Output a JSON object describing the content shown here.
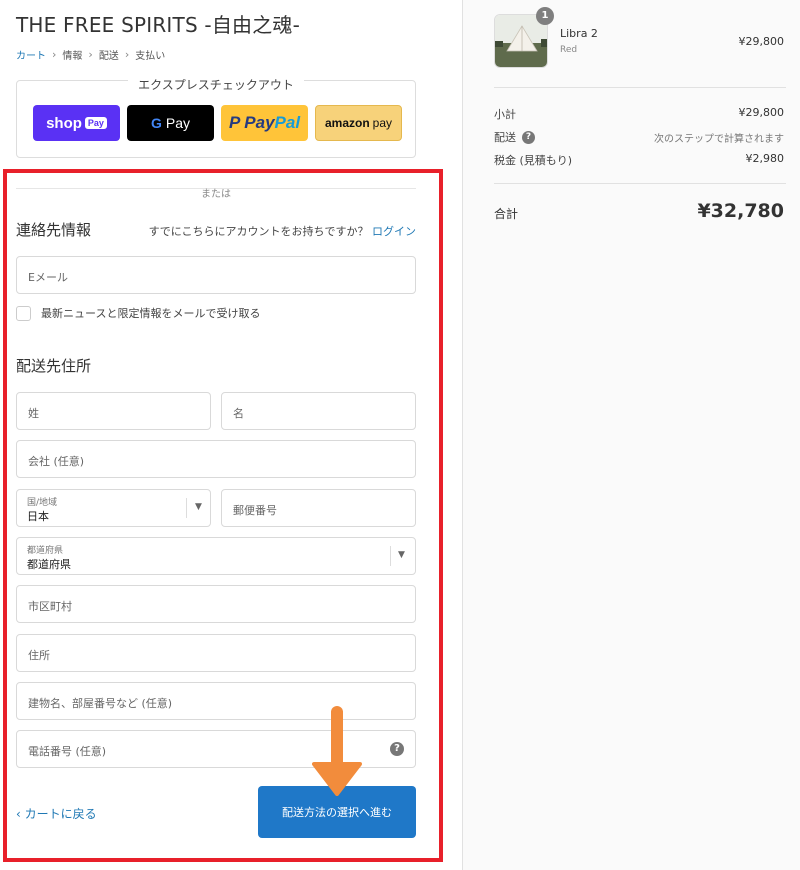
{
  "store": {
    "title": "THE FREE SPIRITS -自由之魂-"
  },
  "breadcrumb": [
    "カート",
    "情報",
    "配送",
    "支払い"
  ],
  "express": {
    "title": "エクスプレスチェックアウト",
    "buttons": {
      "shoppay": {
        "label": "shop",
        "tag": "Pay"
      },
      "gpay": {
        "g": "G",
        "label": "Pay"
      },
      "paypal": {
        "label_a": "Pay",
        "label_b": "Pal",
        "mark": "P"
      },
      "amazon": {
        "label_a": "amazon",
        "label_b": "pay"
      }
    }
  },
  "divider_text": "または",
  "contact": {
    "title": "連絡先情報",
    "have_account": "すでにこちらにアカウントをお持ちですか？",
    "login": "ログイン",
    "email_placeholder": "Eメール",
    "newsletter_label": "最新ニュースと限定情報をメールで受け取る"
  },
  "shipping": {
    "title": "配送先住所",
    "last_name": "姓",
    "first_name": "名",
    "company": "会社 (任意)",
    "country_label": "国/地域",
    "country_value": "日本",
    "postal": "郵便番号",
    "prefecture_label": "都道府県",
    "prefecture_value": "都道府県",
    "city": "市区町村",
    "address": "住所",
    "building": "建物名、部屋番号など (任意)",
    "phone": "電話番号 (任意)",
    "help": "?"
  },
  "actions": {
    "back": "カートに戻る",
    "continue": "配送方法の選択へ進む"
  },
  "order": {
    "item": {
      "qty": "1",
      "name": "Libra 2",
      "variant": "Red",
      "price": "¥29,800"
    },
    "subtotal_label": "小計",
    "subtotal_value": "¥29,800",
    "shipping_label": "配送",
    "shipping_value": "次のステップで計算されます",
    "tax_label": "税金 (見積もり)",
    "tax_value": "¥2,980",
    "total_label": "合計",
    "total_value": "¥32,780"
  },
  "colors": {
    "accent": "#1f78c8",
    "highlight": "#e8202a",
    "arrow": "#f28c3c"
  }
}
